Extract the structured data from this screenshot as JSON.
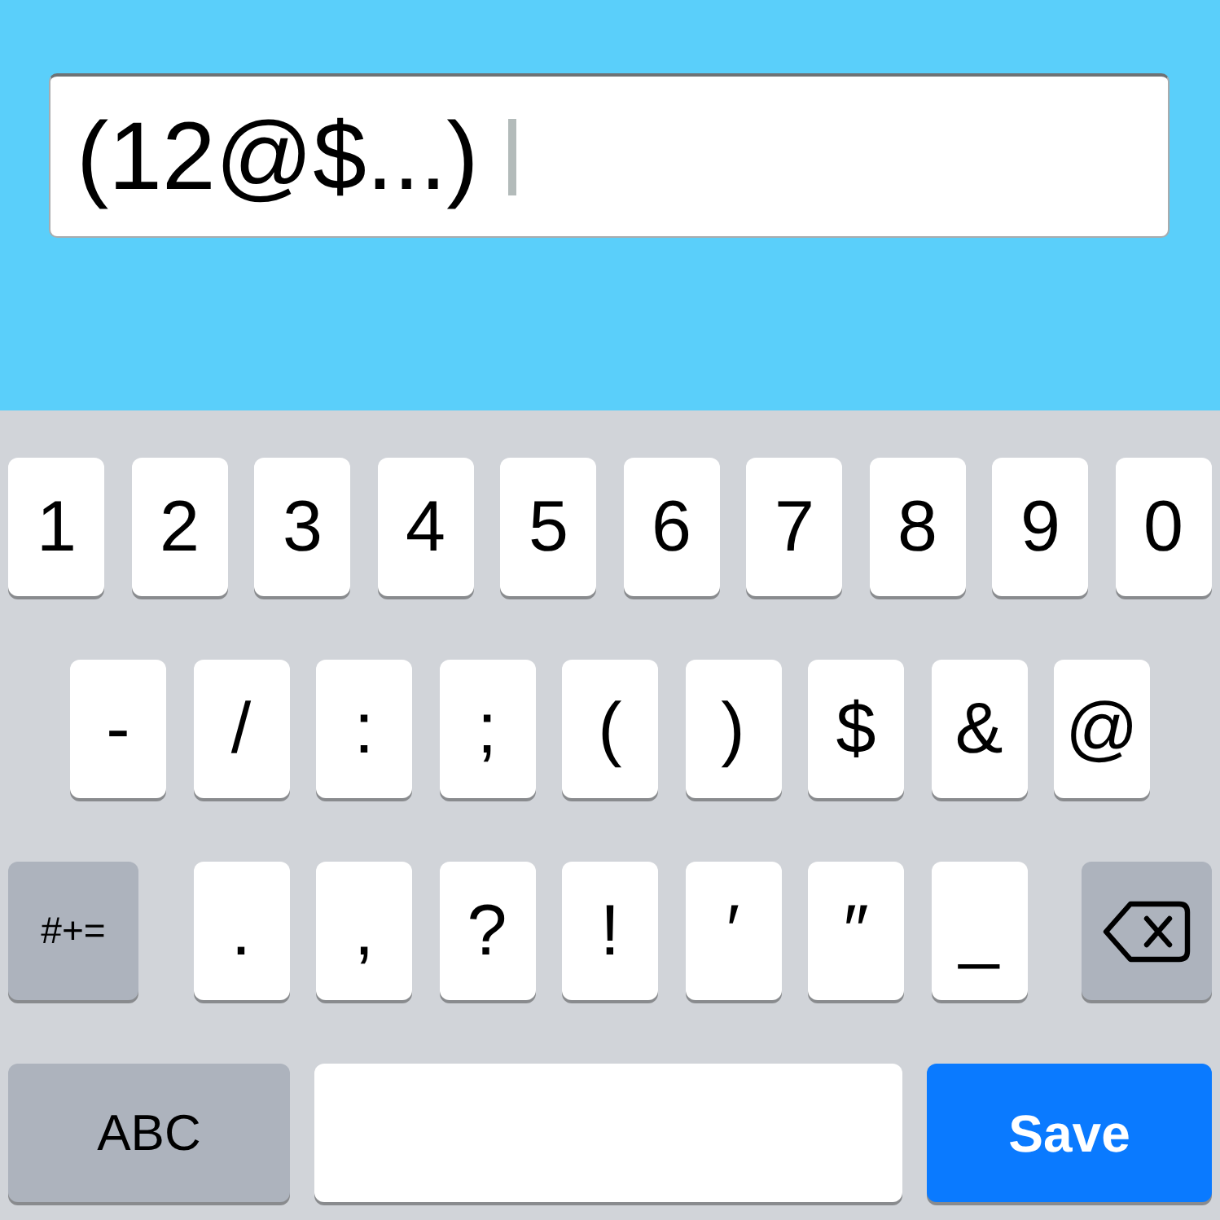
{
  "text_field": {
    "value": "(12@$...)",
    "focused": true
  },
  "keyboard": {
    "rows": [
      {
        "keys": [
          {
            "kind": "char",
            "label": "1"
          },
          {
            "kind": "char",
            "label": "2"
          },
          {
            "kind": "char",
            "label": "3"
          },
          {
            "kind": "char",
            "label": "4"
          },
          {
            "kind": "char",
            "label": "5"
          },
          {
            "kind": "char",
            "label": "6"
          },
          {
            "kind": "char",
            "label": "7"
          },
          {
            "kind": "char",
            "label": "8"
          },
          {
            "kind": "char",
            "label": "9"
          },
          {
            "kind": "char",
            "label": "0"
          }
        ]
      },
      {
        "keys": [
          {
            "kind": "char",
            "label": "-"
          },
          {
            "kind": "char",
            "label": "/"
          },
          {
            "kind": "char",
            "label": ":"
          },
          {
            "kind": "char",
            "label": ";"
          },
          {
            "kind": "char",
            "label": "("
          },
          {
            "kind": "char",
            "label": ")"
          },
          {
            "kind": "char",
            "label": "$"
          },
          {
            "kind": "char",
            "label": "&"
          },
          {
            "kind": "char",
            "label": "@"
          }
        ]
      },
      {
        "keys": [
          {
            "kind": "modifier",
            "label": "#+="
          },
          {
            "kind": "char",
            "label": "."
          },
          {
            "kind": "char",
            "label": ","
          },
          {
            "kind": "char",
            "label": "?"
          },
          {
            "kind": "char",
            "label": "!"
          },
          {
            "kind": "char",
            "label": "′"
          },
          {
            "kind": "char",
            "label": "″"
          },
          {
            "kind": "char",
            "label": "_"
          },
          {
            "kind": "delete"
          }
        ]
      },
      {
        "keys": [
          {
            "kind": "modifier",
            "label": "ABC"
          },
          {
            "kind": "space"
          },
          {
            "kind": "action",
            "label": "Save"
          }
        ]
      }
    ]
  }
}
